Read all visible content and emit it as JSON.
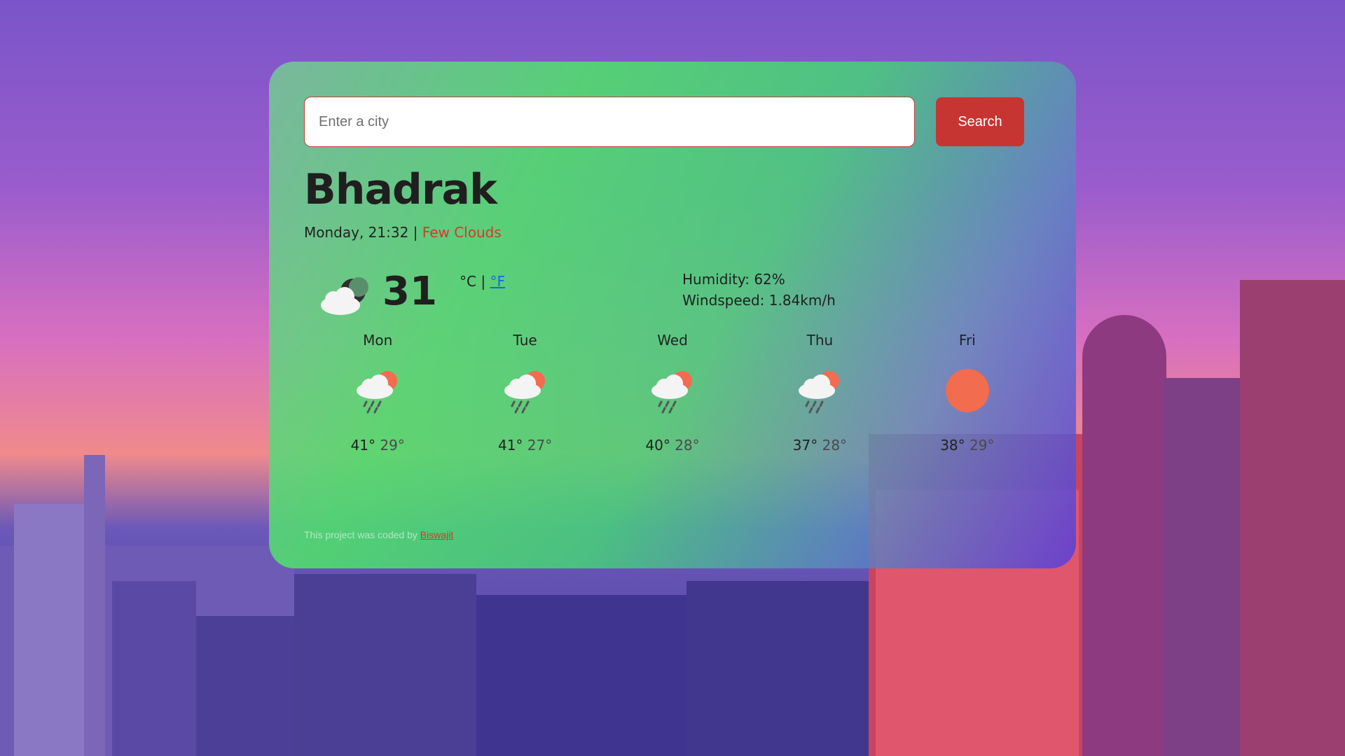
{
  "search": {
    "placeholder": "Enter a city",
    "button_label": "Search"
  },
  "current": {
    "city": "Bhadrak",
    "day_time": "Monday, 21:32",
    "separator": "|",
    "condition": "Few Clouds",
    "icon": "few-clouds-night-icon",
    "temperature": "31",
    "unit_c": "°C",
    "unit_sep": "|",
    "unit_f": "°F",
    "humidity": "Humidity: 62%",
    "windspeed": "Windspeed: 1.84km/h"
  },
  "forecast": [
    {
      "day": "Mon",
      "icon": "rain-sun-icon",
      "high": "41°",
      "low": "29°"
    },
    {
      "day": "Tue",
      "icon": "rain-sun-icon",
      "high": "41°",
      "low": "27°"
    },
    {
      "day": "Wed",
      "icon": "rain-sun-icon",
      "high": "40°",
      "low": "28°"
    },
    {
      "day": "Thu",
      "icon": "rain-sun-icon",
      "high": "37°",
      "low": "28°"
    },
    {
      "day": "Fri",
      "icon": "sun-icon",
      "high": "38°",
      "low": "29°"
    }
  ],
  "footer": {
    "text": "This project was coded by",
    "author": "Biswajit"
  },
  "colors": {
    "accent": "#c73532",
    "condition": "#d23a2e",
    "link": "#1565e8",
    "sun": "#f26c4f"
  }
}
